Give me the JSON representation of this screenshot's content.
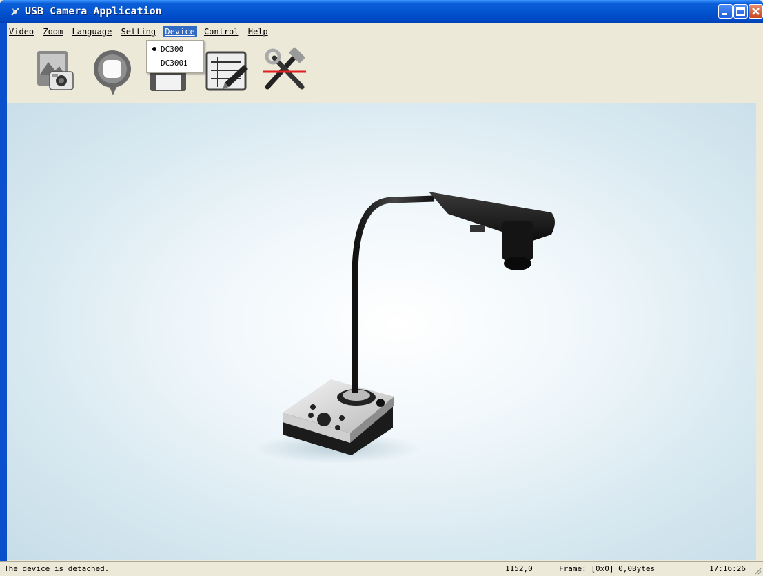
{
  "window": {
    "title": "USB Camera Application"
  },
  "menu": {
    "items": [
      {
        "label": "Video"
      },
      {
        "label": "Zoom"
      },
      {
        "label": "Language"
      },
      {
        "label": "Setting"
      },
      {
        "label": "Device"
      },
      {
        "label": "Control"
      },
      {
        "label": "Help"
      }
    ],
    "active": "Device"
  },
  "device_menu": {
    "options": [
      {
        "label": "DC300",
        "selected": true
      },
      {
        "label": "DC300i",
        "selected": false
      }
    ]
  },
  "toolbar": {
    "tools": [
      {
        "icon": "photo-camera-icon"
      },
      {
        "icon": "record-bubble-icon"
      },
      {
        "icon": "floppy-save-icon"
      },
      {
        "icon": "annotate-pen-icon"
      },
      {
        "icon": "tools-wrench-hammer-icon"
      }
    ]
  },
  "status": {
    "message": "The device is detached.",
    "coords": "1152,0",
    "frame": "Frame: [0x0] 0,0Bytes",
    "time": "17:16:26"
  },
  "colors": {
    "titlebar": "#0454d0",
    "menu_highlight": "#316ac5",
    "close_button": "#c9441b"
  }
}
